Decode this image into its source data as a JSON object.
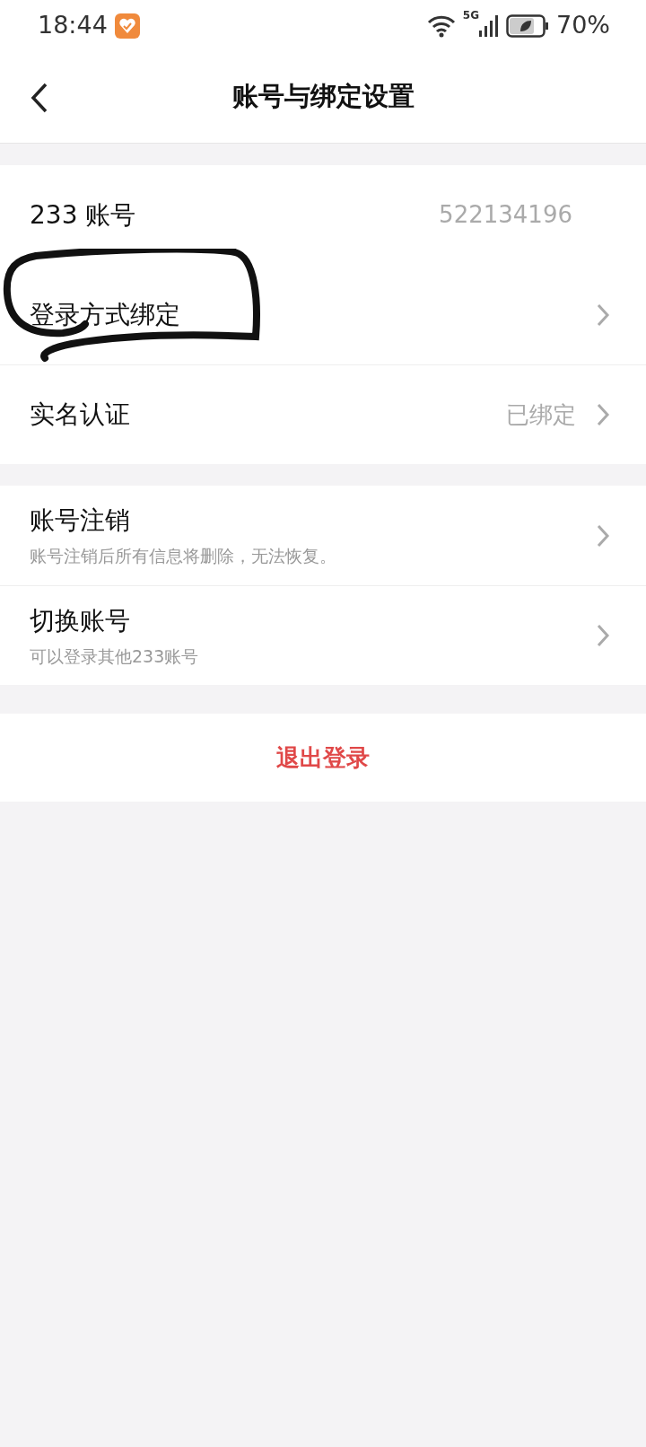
{
  "status_bar": {
    "time": "18:44",
    "network": "5G",
    "battery": "70%"
  },
  "header": {
    "title": "账号与绑定设置"
  },
  "groups": [
    {
      "items": [
        {
          "kind": "value",
          "label": "233 账号",
          "value": "522134196",
          "chevron": false,
          "circled": false
        },
        {
          "kind": "link",
          "label": "登录方式绑定",
          "chevron": true,
          "circled": true
        },
        {
          "kind": "link",
          "label": "实名认证",
          "value": "已绑定",
          "chevron": true,
          "circled": false
        }
      ]
    },
    {
      "items": [
        {
          "kind": "sub",
          "label": "账号注销",
          "subtitle": "账号注销后所有信息将删除，无法恢复。",
          "chevron": true,
          "circled": false
        },
        {
          "kind": "sub",
          "label": "切换账号",
          "subtitle": "可以登录其他233账号",
          "chevron": true,
          "circled": false
        }
      ]
    }
  ],
  "logout": "退出登录"
}
